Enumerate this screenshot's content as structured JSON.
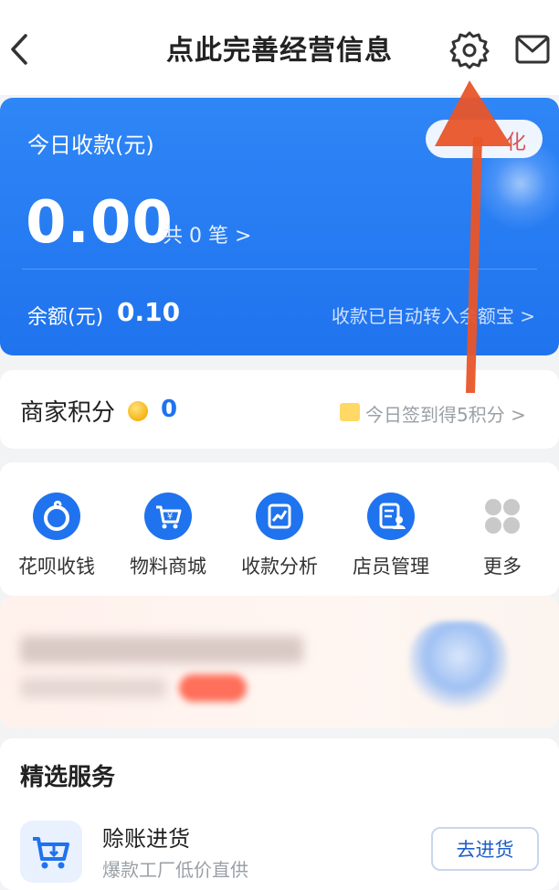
{
  "header": {
    "title": "点此完善经营信息",
    "back_icon": "chevron-left-icon",
    "settings_icon": "gear-icon",
    "mail_icon": "mail-icon"
  },
  "income_card": {
    "title": "今日收款(元)",
    "amount": "0.00",
    "count_text": "共 0 笔 >",
    "pill_text": "化",
    "balance_label": "余额(元)",
    "balance_value": "0.10",
    "auto_transfer_text": "收款已自动转入余额宝 >",
    "accent_color": "#1f73ee"
  },
  "points": {
    "label": "商家积分",
    "value": "0",
    "signin_text": "今日签到得5积分 >"
  },
  "quick_actions": [
    {
      "label": "花呗收钱",
      "icon": "huabei-icon"
    },
    {
      "label": "物料商城",
      "icon": "shopping-cart-icon"
    },
    {
      "label": "收款分析",
      "icon": "chart-icon"
    },
    {
      "label": "店员管理",
      "icon": "staff-icon"
    },
    {
      "label": "更多",
      "icon": "more-grid-icon"
    }
  ],
  "services": {
    "title": "精选服务",
    "items": [
      {
        "name": "赊账进货",
        "desc": "爆款工厂低价直供",
        "button": "去进货",
        "icon": "cart-download-icon"
      }
    ]
  },
  "annotation": {
    "arrow_color": "#e8552a"
  }
}
